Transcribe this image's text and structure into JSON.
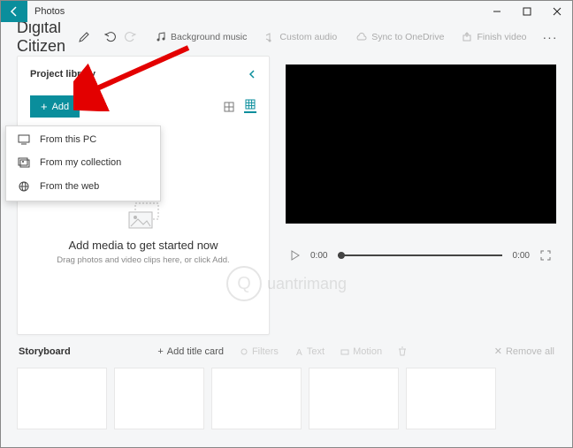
{
  "app": {
    "title": "Photos"
  },
  "project": {
    "name": "Digital Citizen"
  },
  "toolbar": {
    "bg_music": "Background music",
    "custom_audio": "Custom audio",
    "sync": "Sync to OneDrive",
    "finish": "Finish video"
  },
  "library": {
    "title": "Project library",
    "add_label": "Add",
    "empty_title": "Add media to get started now",
    "empty_sub": "Drag photos and video clips here, or click Add."
  },
  "dropdown": {
    "pc": "From this PC",
    "collection": "From my collection",
    "web": "From the web"
  },
  "playback": {
    "current": "0:00",
    "total": "0:00"
  },
  "storyboard": {
    "title": "Storyboard",
    "add_title_card": "Add title card",
    "filters": "Filters",
    "text": "Text",
    "motion": "Motion",
    "remove_all": "Remove all"
  },
  "watermark": {
    "brand": "uantrimang",
    "initial": "Q"
  }
}
